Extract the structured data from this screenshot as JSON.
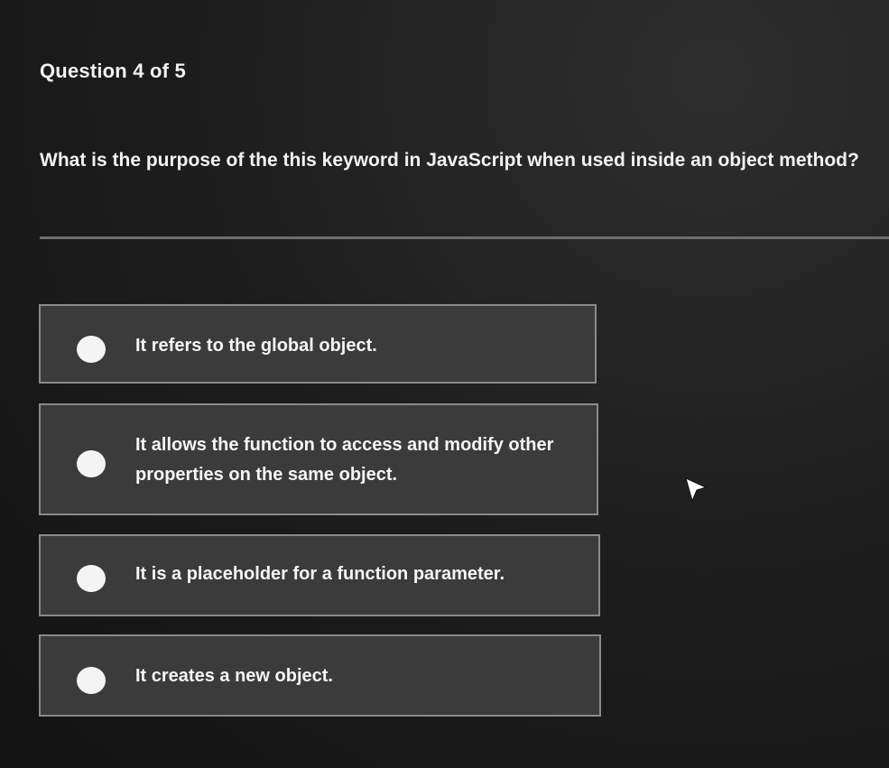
{
  "quiz": {
    "counter": "Question 4 of 5",
    "question": "What is the purpose of the this keyword in JavaScript when used inside an object method?",
    "options": [
      {
        "label": "It refers to the global object."
      },
      {
        "label": "It allows the function to access and modify other properties on the same object."
      },
      {
        "label": "It is a placeholder for a function parameter."
      },
      {
        "label": "It creates a new object."
      }
    ]
  },
  "icons": {
    "radio": "radio-unselected-icon",
    "cursor": "mouse-pointer-icon"
  },
  "colors": {
    "background": "#1b1b1b",
    "option_fill": "#3b3b3b",
    "option_border": "#8a8a8a",
    "text": "#f2f2f2"
  }
}
